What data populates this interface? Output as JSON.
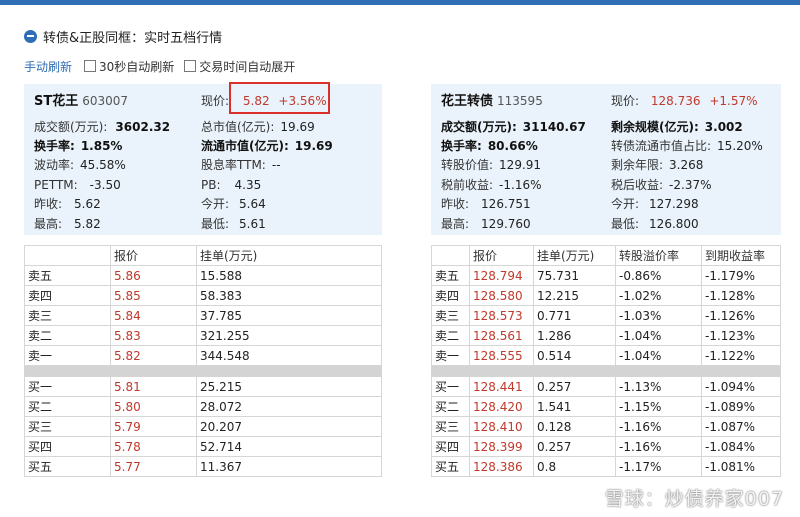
{
  "header": {
    "title": "转债&正股同框：实时五档行情",
    "manual_refresh": "手动刷新",
    "auto_refresh_30s": "30秒自动刷新",
    "auto_expand_trading": "交易时间自动展开"
  },
  "stock": {
    "name": "ST花王",
    "code": "603007",
    "price_label": "现价:",
    "price": "5.82",
    "change": "+3.56%",
    "fields": [
      {
        "label": "成交额(万元):",
        "value": "3602.32"
      },
      {
        "label": "总市值(亿元):",
        "value": "19.69"
      },
      {
        "label": "换手率:",
        "value": "1.85%"
      },
      {
        "label": "流通市值(亿元):",
        "value": "19.69"
      },
      {
        "label": "波动率:",
        "value": "45.58%"
      },
      {
        "label": "股息率TTM:",
        "value": "--"
      },
      {
        "label": "PETTM:",
        "value": "-3.50"
      },
      {
        "label": "PB:",
        "value": "4.35"
      },
      {
        "label": "昨收:",
        "value": "5.62"
      },
      {
        "label": "今开:",
        "value": "5.64"
      },
      {
        "label": "最高:",
        "value": "5.82"
      },
      {
        "label": "最低:",
        "value": "5.61"
      }
    ],
    "table_headers": [
      "",
      "报价",
      "挂单(万元)"
    ],
    "asks": [
      {
        "level": "卖五",
        "price": "5.86",
        "volume": "15.588"
      },
      {
        "level": "卖四",
        "price": "5.85",
        "volume": "58.383"
      },
      {
        "level": "卖三",
        "price": "5.84",
        "volume": "37.785"
      },
      {
        "level": "卖二",
        "price": "5.83",
        "volume": "321.255"
      },
      {
        "level": "卖一",
        "price": "5.82",
        "volume": "344.548"
      }
    ],
    "bids": [
      {
        "level": "买一",
        "price": "5.81",
        "volume": "25.215"
      },
      {
        "level": "买二",
        "price": "5.80",
        "volume": "28.072"
      },
      {
        "level": "买三",
        "price": "5.79",
        "volume": "20.207"
      },
      {
        "level": "买四",
        "price": "5.78",
        "volume": "52.714"
      },
      {
        "level": "买五",
        "price": "5.77",
        "volume": "11.367"
      }
    ]
  },
  "bond": {
    "name": "花王转债",
    "code": "113595",
    "price_label": "现价:",
    "price": "128.736",
    "change": "+1.57%",
    "fields": [
      {
        "label": "成交额(万元):",
        "value": "31140.67"
      },
      {
        "label": "剩余规模(亿元):",
        "value": "3.002"
      },
      {
        "label": "换手率:",
        "value": "80.66%"
      },
      {
        "label": "转债流通市值占比:",
        "value": "15.20%"
      },
      {
        "label": "转股价值:",
        "value": "129.91"
      },
      {
        "label": "剩余年限:",
        "value": "3.268"
      },
      {
        "label": "税前收益:",
        "value": "-1.16%"
      },
      {
        "label": "税后收益:",
        "value": "-2.37%"
      },
      {
        "label": "昨收:",
        "value": "126.751"
      },
      {
        "label": "今开:",
        "value": "127.298"
      },
      {
        "label": "最高:",
        "value": "129.760"
      },
      {
        "label": "最低:",
        "value": "126.800"
      }
    ],
    "table_headers": [
      "",
      "报价",
      "挂单(万元)",
      "转股溢价率",
      "到期收益率"
    ],
    "asks": [
      {
        "level": "卖五",
        "price": "128.794",
        "volume": "75.731",
        "premium": "-0.86%",
        "ytm": "-1.179%"
      },
      {
        "level": "卖四",
        "price": "128.580",
        "volume": "12.215",
        "premium": "-1.02%",
        "ytm": "-1.128%"
      },
      {
        "level": "卖三",
        "price": "128.573",
        "volume": "0.771",
        "premium": "-1.03%",
        "ytm": "-1.126%"
      },
      {
        "level": "卖二",
        "price": "128.561",
        "volume": "1.286",
        "premium": "-1.04%",
        "ytm": "-1.123%"
      },
      {
        "level": "卖一",
        "price": "128.555",
        "volume": "0.514",
        "premium": "-1.04%",
        "ytm": "-1.122%"
      }
    ],
    "bids": [
      {
        "level": "买一",
        "price": "128.441",
        "volume": "0.257",
        "premium": "-1.13%",
        "ytm": "-1.094%"
      },
      {
        "level": "买二",
        "price": "128.420",
        "volume": "1.541",
        "premium": "-1.15%",
        "ytm": "-1.089%"
      },
      {
        "level": "买三",
        "price": "128.410",
        "volume": "0.128",
        "premium": "-1.16%",
        "ytm": "-1.087%"
      },
      {
        "level": "买四",
        "price": "128.399",
        "volume": "0.257",
        "premium": "-1.16%",
        "ytm": "-1.084%"
      },
      {
        "level": "买五",
        "price": "128.386",
        "volume": "0.8",
        "premium": "-1.17%",
        "ytm": "-1.081%"
      }
    ]
  },
  "watermark": "雪球：炒债养家007"
}
